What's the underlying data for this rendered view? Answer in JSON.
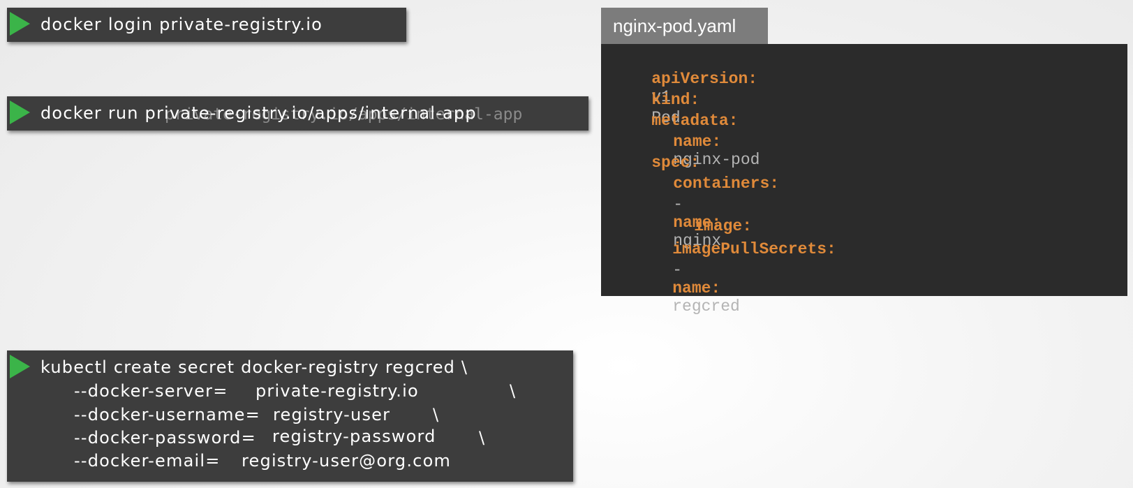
{
  "terminal_login": {
    "command": "docker login private-registry.io"
  },
  "terminal_run": {
    "command": "docker run private-registry.io/apps/internal-app",
    "ghost_text": "private-registry.io/apps/internal-app"
  },
  "terminal_secret": {
    "line1": "kubectl create secret docker-registry regcred \\",
    "options": [
      {
        "flag": "--docker-server=",
        "value": "private-registry.io",
        "continuation": "\\"
      },
      {
        "flag": "--docker-username=",
        "value": "registry-user",
        "continuation": "\\"
      },
      {
        "flag": "--docker-password=",
        "value": "registry-password",
        "continuation": "\\"
      },
      {
        "flag": "--docker-email=",
        "value": "registry-user@org.com",
        "continuation": ""
      }
    ]
  },
  "yaml_file": {
    "filename": "nginx-pod.yaml",
    "lines": [
      {
        "key": "apiVersion:",
        "value": "v1"
      },
      {
        "key": "kind:",
        "value": "Pod"
      },
      {
        "key": "metadata:",
        "value": ""
      },
      {
        "key": "name:",
        "value": "nginx-pod"
      },
      {
        "key": "spec:",
        "value": ""
      },
      {
        "key": "containers:",
        "value": ""
      },
      {
        "dash": "-",
        "key": "name:",
        "value": "nginx"
      },
      {
        "key": "image:",
        "value": ""
      },
      {
        "key": "imagePullSecrets:",
        "value": ""
      },
      {
        "dash": "-",
        "key": "name:",
        "value": "regcred"
      }
    ]
  },
  "colors": {
    "terminal_bg": "#3d3d3d",
    "play_icon": "#3bb449",
    "yaml_bg": "#2b2b2b",
    "yaml_tab_bg": "#7c7c7c",
    "yaml_key": "#e08a3a",
    "yaml_value": "#b4b4b4"
  }
}
